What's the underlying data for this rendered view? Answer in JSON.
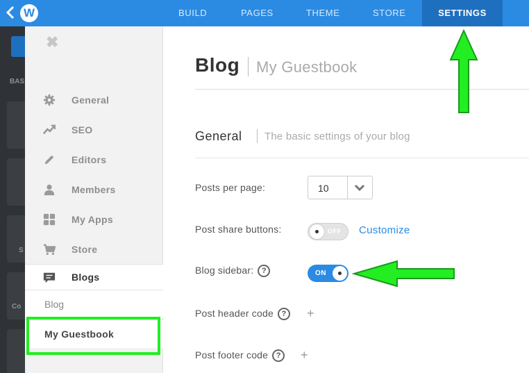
{
  "topbar": {
    "back_icon": "chevron-left-icon",
    "logo_letter": "W",
    "nav": [
      {
        "label": "BUILD",
        "active": false
      },
      {
        "label": "PAGES",
        "active": false
      },
      {
        "label": "THEME",
        "active": false
      },
      {
        "label": "STORE",
        "active": false
      },
      {
        "label": "SETTINGS",
        "active": true
      }
    ]
  },
  "underlying": {
    "bas_label": "BAS",
    "s_label": "S",
    "co_label": "Co"
  },
  "sidebar": {
    "close_icon": "close-icon",
    "items": [
      {
        "label": "General",
        "icon": "gear-icon"
      },
      {
        "label": "SEO",
        "icon": "trend-icon"
      },
      {
        "label": "Editors",
        "icon": "pencil-icon"
      },
      {
        "label": "Members",
        "icon": "person-icon"
      },
      {
        "label": "My Apps",
        "icon": "apps-grid-icon"
      },
      {
        "label": "Store",
        "icon": "cart-icon"
      },
      {
        "label": "Blogs",
        "icon": "comment-icon",
        "active": true
      }
    ],
    "sub_items": [
      {
        "label": "Blog"
      },
      {
        "label": "My Guestbook",
        "selected": true
      }
    ]
  },
  "main": {
    "title": "Blog",
    "subtitle": "My Guestbook",
    "section_title": "General",
    "section_desc": "The basic settings of your blog",
    "posts_per_page": {
      "label": "Posts per page:",
      "value": "10"
    },
    "share_buttons": {
      "label": "Post share buttons:",
      "toggle_text": "OFF",
      "link": "Customize"
    },
    "blog_sidebar": {
      "label": "Blog sidebar:",
      "help": "?",
      "toggle_text": "ON"
    },
    "header_code": {
      "label": "Post header code",
      "help": "?",
      "add": "+"
    },
    "footer_code": {
      "label": "Post footer code",
      "help": "?",
      "add": "+"
    }
  },
  "colors": {
    "brand_blue": "#2b8be3",
    "active_tab": "#1f6fbf",
    "annotation_green": "#22ee22"
  }
}
